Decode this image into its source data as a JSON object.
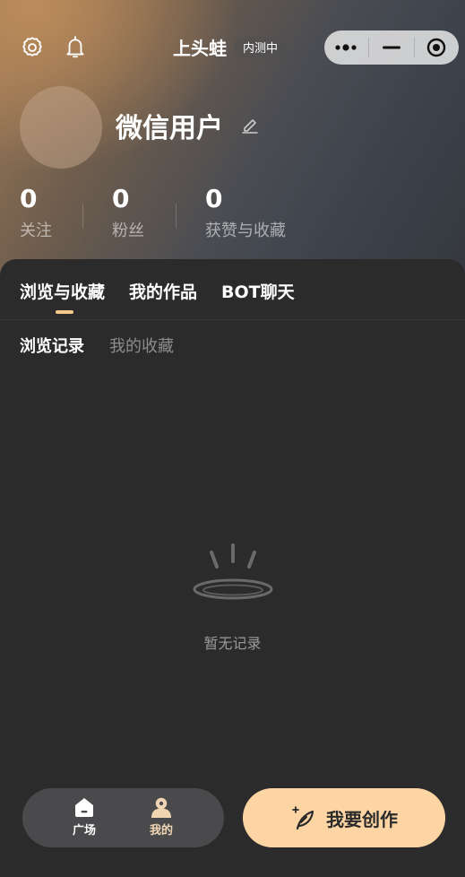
{
  "header": {
    "app_title": "上头蛙",
    "badge": "内测中",
    "icons": [
      "gear-icon",
      "bell-icon",
      "more-icon",
      "minimize-icon",
      "close-target-icon"
    ]
  },
  "profile": {
    "username": "微信用户"
  },
  "stats": [
    {
      "value": "0",
      "label": "关注"
    },
    {
      "value": "0",
      "label": "粉丝"
    },
    {
      "value": "0",
      "label": "获赞与收藏"
    }
  ],
  "tabs": [
    {
      "label": "浏览与收藏",
      "active": true
    },
    {
      "label": "我的作品",
      "active": false
    },
    {
      "label": "BOT聊天",
      "active": false
    }
  ],
  "subtabs": [
    {
      "label": "浏览记录",
      "active": true
    },
    {
      "label": "我的收藏",
      "active": false
    }
  ],
  "empty_state": {
    "text": "暂无记录"
  },
  "bottom_nav": [
    {
      "label": "广场",
      "icon": "home-icon",
      "active": false
    },
    {
      "label": "我的",
      "icon": "user-icon",
      "active": true
    }
  ],
  "create_button": {
    "label": "我要创作",
    "icon": "feather-sparkle-icon"
  },
  "colors": {
    "accent": "#fdd5a5",
    "tab_indicator": "#f5c98c",
    "panel_bg": "#2b2b2b"
  }
}
